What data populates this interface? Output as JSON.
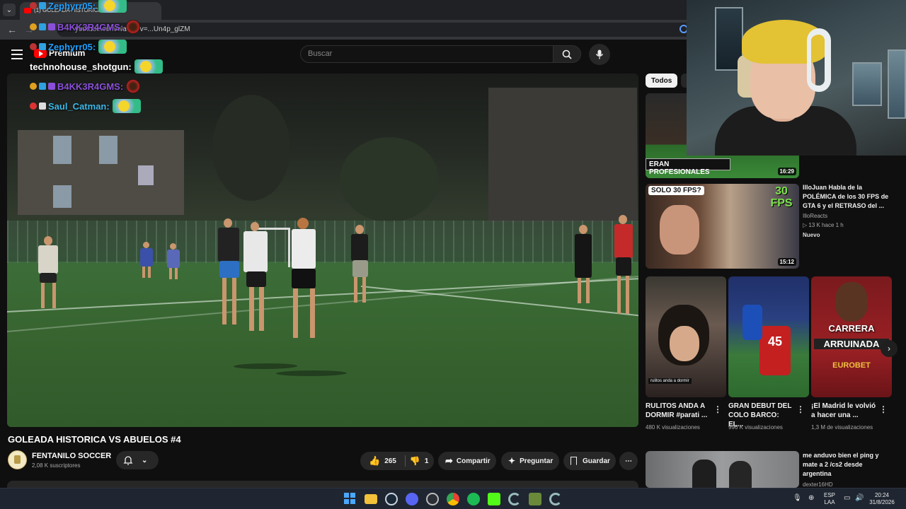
{
  "browser": {
    "tab_title": "(1) GOLEADA HISTORICA VS A",
    "url": "youtube.com/watch?v=...Un4p_glZM"
  },
  "header": {
    "brand": "Premium",
    "search_placeholder": "Buscar"
  },
  "chat": [
    {
      "user": "Zephyrr05:",
      "color": "#1e9fff"
    },
    {
      "user": "B4KK3R4GMS:",
      "color": "#8a4fd8"
    },
    {
      "user": "Zephyrr05:",
      "color": "#1e9fff"
    },
    {
      "user": "technohouse_shotgun:",
      "color": "#ffffff"
    },
    {
      "user": "B4KK3R4GMS:",
      "color": "#8a4fd8"
    },
    {
      "user": "Saul_Catman:",
      "color": "#3db8e8"
    }
  ],
  "video": {
    "title": "GOLEADA HISTORICA VS ABUELOS #4",
    "channel": "FENTANILO SOCCER",
    "subscribers": "2,08 K suscriptores",
    "likes": "265",
    "dislikes": "1",
    "share_label": "Compartir",
    "ask_label": "Preguntar",
    "save_label": "Guardar"
  },
  "chips": {
    "all": "Todos"
  },
  "recommendations": [
    {
      "thumb_text": "ERAN PROFESIONALES",
      "duration": "16:29",
      "title": "",
      "channel": "",
      "meta": "",
      "badge": ""
    },
    {
      "thumb_text": "SOLO 30 FPS?",
      "thumb_text2": "30 FPS",
      "duration": "15:12",
      "title": "IlloJuan Habla de la POLÉMICA de los 30 FPS de GTA 6 y el RETRASO del ...",
      "channel": "IlloReacts",
      "meta": "▷ 13 K  hace 1 h",
      "badge": "Nuevo"
    }
  ],
  "shorts": [
    {
      "title": "RULITOS ANDA A DORMIR #parati ...",
      "views": "480 K visualizaciones",
      "caption": "rulitos anda a dormir"
    },
    {
      "title": "GRAN DEBUT DEL COLO BARCO: EL...",
      "views": "996 K visualizaciones",
      "jersey": "45"
    },
    {
      "title": "¡El Madrid le volvió a hacer una ...",
      "views": "1,3 M de visualizaciones",
      "text1": "CARRERA",
      "text2": "ARRUINADA",
      "sponsor": "EUROBET"
    }
  ],
  "rec_bottom": {
    "title": "me anduvo bien el ping y mate a 2 /cs2 desde argentina",
    "channel": "dexter16HD"
  },
  "tray": {
    "lang1": "ESP",
    "lang2": "LAA",
    "time": "20:24",
    "date": "31/8/2026"
  }
}
